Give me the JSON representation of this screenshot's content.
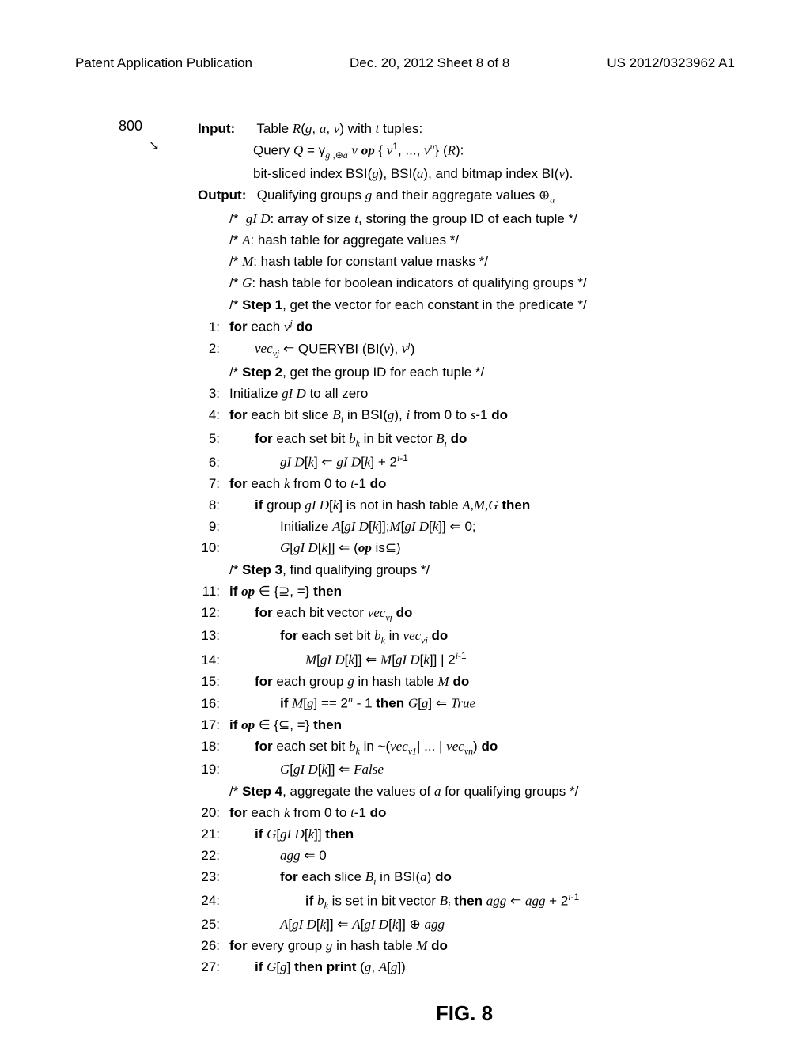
{
  "header": {
    "left": "Patent Application Publication",
    "center": "Dec. 20, 2012  Sheet 8 of 8",
    "right": "US 2012/0323962 A1"
  },
  "figure": {
    "label": "800",
    "caption": "FIG. 8"
  },
  "algorithm": {
    "input_label": "Input:",
    "input_line1": "Table R(g, a, v) with t tuples:",
    "input_line2": "Query Q = γg ,⊕a v op { v¹, ..., vⁿ} (R):",
    "input_line3": "bit-sliced index BSI(g), BSI(a), and bitmap index BI(v).",
    "output_label": "Output:",
    "output_line": "Qualifying groups g and their aggregate values ⊕a",
    "comment1": "/*  gI D: array of size t, storing the group ID of each tuple */",
    "comment2": "/* A: hash table for aggregate values */",
    "comment3": "/* M: hash table for constant value masks */",
    "comment4": "/* G: hash table for boolean indicators of qualifying groups */",
    "step1": "/* Step 1, get the vector for each constant in the predicate */",
    "line1": "for each vʲ do",
    "line2": "vecᵥⱼ ⇐ QUERYBI (BI(v), vʲ)",
    "step2": "/* Step 2, get the group ID for each tuple */",
    "line3": "Initialize gI D to all zero",
    "line4": "for each bit slice Bᵢ in BSI(g), i from 0 to s-1 do",
    "line5": "for each set bit bₖ in bit vector Bᵢ do",
    "line6": "gI D[k] ⇐ gI D[k] + 2ⁱ⁻¹",
    "line7": "for each k from 0 to t-1 do",
    "line8": "if group gI D[k] is not in hash table A,M,G then",
    "line9": "Initialize A[gI D[k]];M[gI D[k]] ⇐ 0;",
    "line10": "G[gI D[k]] ⇐ (op is⊆)",
    "step3": "/* Step 3, find qualifying groups */",
    "line11": "if op ∈ {⊇, =} then",
    "line12": "for each bit vector vecᵥⱼ do",
    "line13": "for each set bit bₖ in vecᵥⱼ do",
    "line14": "M[gI D[k]] ⇐ M[gI D[k]] | 2ⁱ⁻¹",
    "line15": "for each group g in hash table M do",
    "line16": "if M[g] == 2ⁿ - 1 then G[g] ⇐ True",
    "line17": "if op ∈ {⊆, =} then",
    "line18": "for each set bit bₖ in ~(vecᵥ₁| ... | vecᵥₙ) do",
    "line19": "G[gI D[k]] ⇐ False",
    "step4": "/* Step 4, aggregate the values of a for qualifying groups */",
    "line20": "for each k from 0 to t-1 do",
    "line21": "if G[gI D[k]] then",
    "line22": "agg ⇐ 0",
    "line23": "for each slice Bᵢ in BSI(a) do",
    "line24": "if bₖ is set in bit vector Bᵢ then agg ⇐ agg + 2ⁱ⁻¹",
    "line25": "A[gI D[k]] ⇐ A[gI D[k]] ⊕ agg",
    "line26": "for every group g in hash table M do",
    "line27": "if G[g] then print (g, A[g])"
  }
}
